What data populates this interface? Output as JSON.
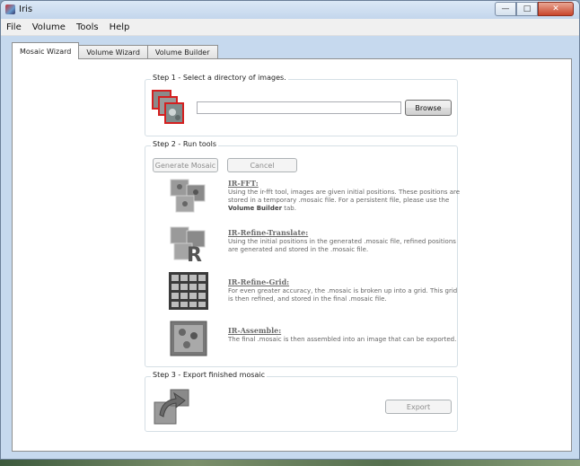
{
  "window": {
    "title": "Iris"
  },
  "menu": [
    "File",
    "Volume",
    "Tools",
    "Help"
  ],
  "tabs": [
    {
      "label": "Mosaic Wizard",
      "active": true
    },
    {
      "label": "Volume Wizard",
      "active": false
    },
    {
      "label": "Volume Builder",
      "active": false
    }
  ],
  "step1": {
    "title": "Step 1 - Select a directory of images.",
    "path_value": "",
    "browse_label": "Browse"
  },
  "step2": {
    "title": "Step 2 - Run tools",
    "generate_label": "Generate Mosaic",
    "cancel_label": "Cancel",
    "tools": [
      {
        "title": "IR-FFT:",
        "desc_pre": "Using the ir-fft tool, images are given initial positions.  These positions are stored in a temporary .mosaic file.  For a persistent file, please use the ",
        "desc_bold": "Volume Builder",
        "desc_post": " tab."
      },
      {
        "title": "IR-Refine-Translate:",
        "desc_pre": "Using the initial positions in the generated .mosaic file, refined positions are generated and stored in the .mosaic file.",
        "desc_bold": "",
        "desc_post": ""
      },
      {
        "title": "IR-Refine-Grid:",
        "desc_pre": "For even greater accuracy, the .mosaic is broken up into a grid.  This grid is then refined, and stored in the final .mosaic file.",
        "desc_bold": "",
        "desc_post": ""
      },
      {
        "title": "IR-Assemble:",
        "desc_pre": "The final .mosaic is then assembled into an image that can be exported.",
        "desc_bold": "",
        "desc_post": ""
      }
    ]
  },
  "step3": {
    "title": "Step 3 - Export finished mosaic",
    "export_label": "Export"
  },
  "colors": {
    "group_border": "#d5dfe5",
    "icon_red": "#d42020",
    "disabled_text": "#8d8d8d"
  }
}
